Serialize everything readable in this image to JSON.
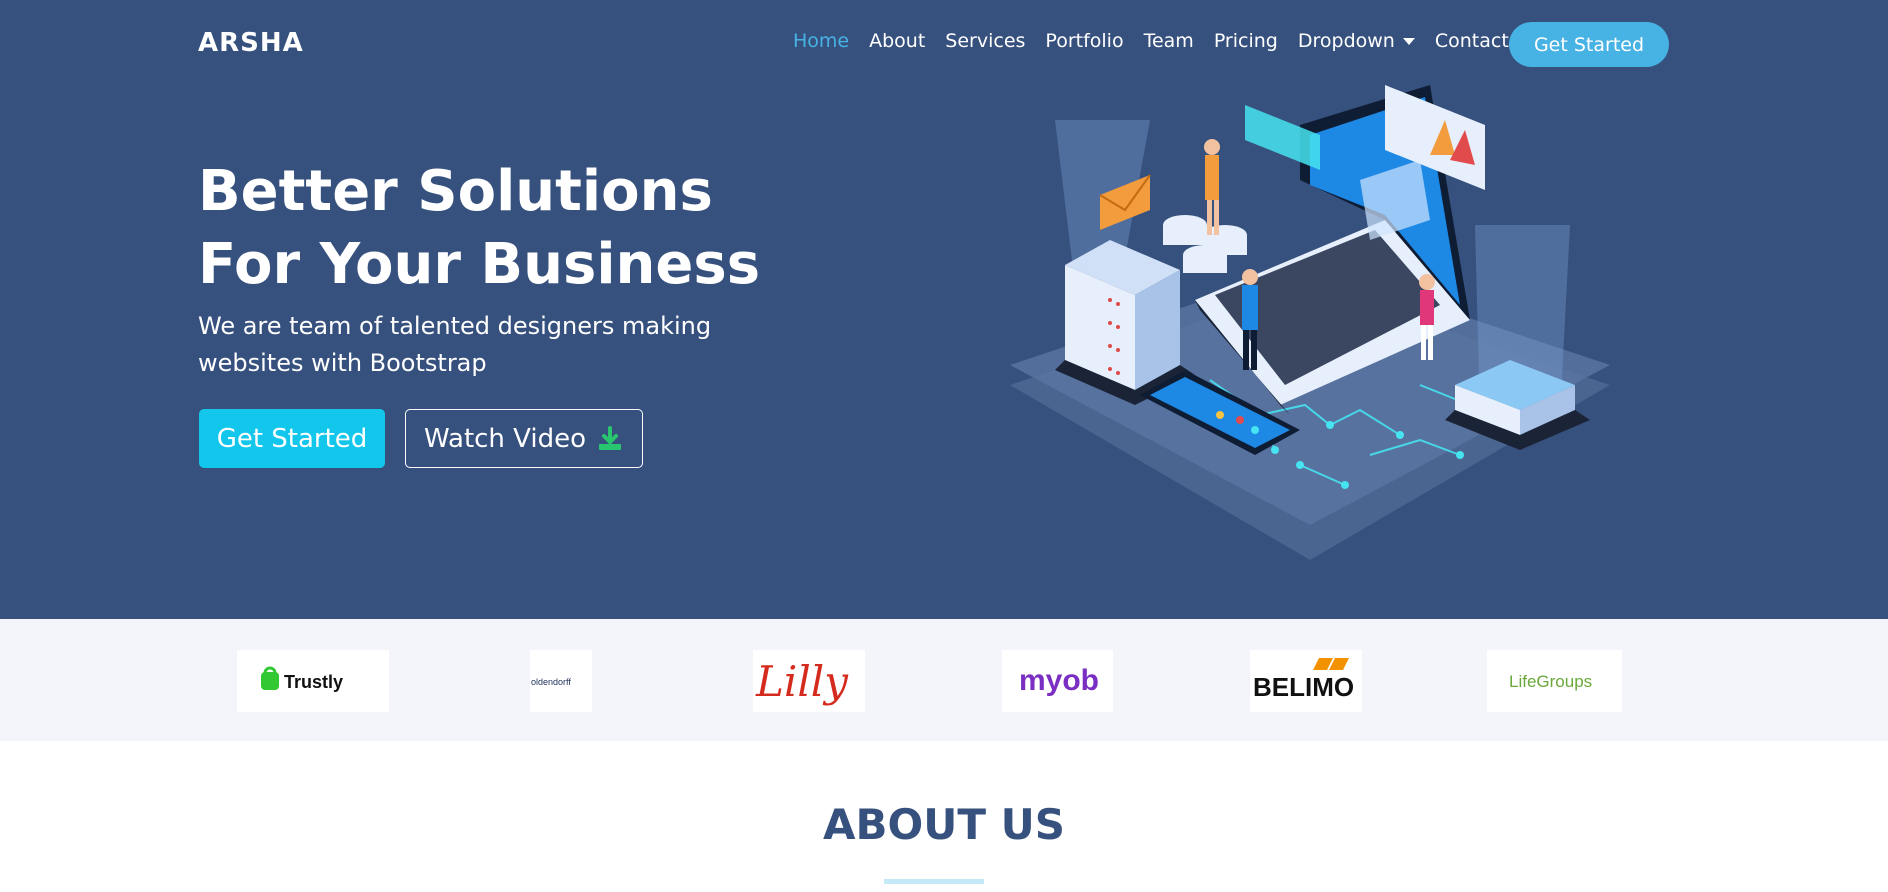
{
  "brand": "ARSHA",
  "nav": {
    "items": [
      {
        "label": "Home",
        "active": true
      },
      {
        "label": "About"
      },
      {
        "label": "Services"
      },
      {
        "label": "Portfolio"
      },
      {
        "label": "Team"
      },
      {
        "label": "Pricing"
      },
      {
        "label": "Dropdown"
      },
      {
        "label": "Contact"
      }
    ],
    "cta": "Get Started"
  },
  "hero": {
    "title": "Better Solutions For Your Business",
    "subtitle": "We are team of talented designers making websites with Bootstrap",
    "primary_button": "Get Started",
    "secondary_button": "Watch Video",
    "secondary_icon": "download-icon"
  },
  "clients": [
    {
      "name": "Trustly"
    },
    {
      "name": "oldendorff"
    },
    {
      "name": "Lilly"
    },
    {
      "name": "myob"
    },
    {
      "name": "BELIMO"
    },
    {
      "name": "LifeGroups"
    }
  ],
  "about": {
    "title": "ABOUT US"
  },
  "colors": {
    "hero_bg": "#37517e",
    "accent": "#47b2e4",
    "primary_button": "#12c6ec",
    "clients_bg": "#f3f5fa"
  }
}
